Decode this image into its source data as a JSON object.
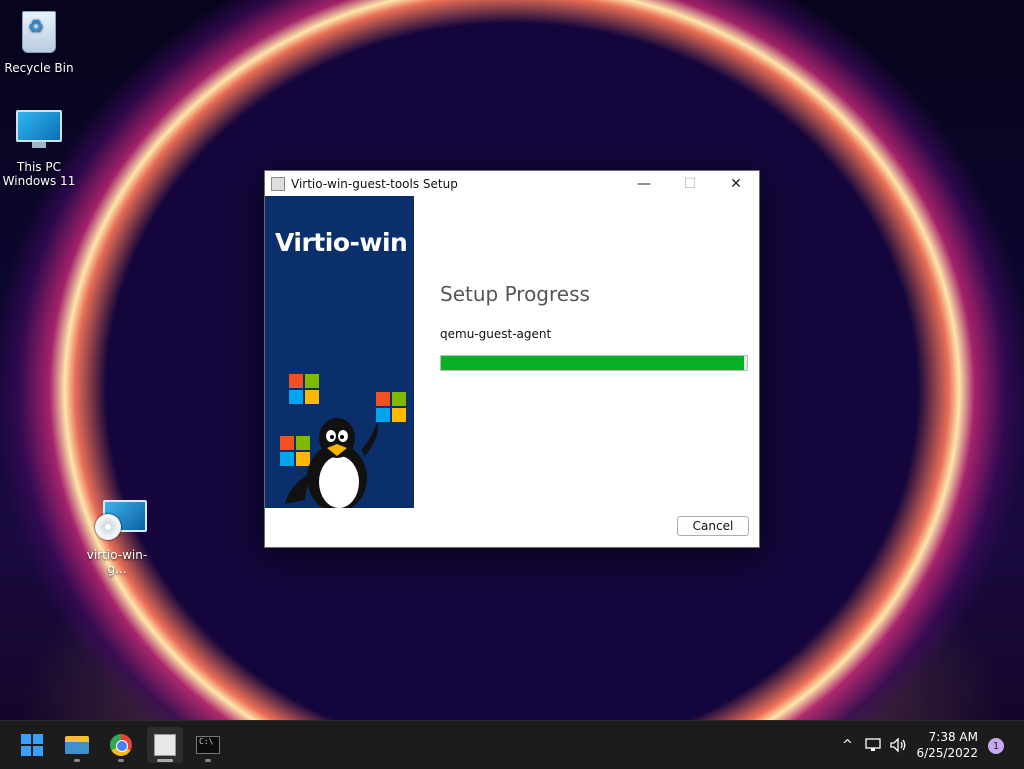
{
  "desktop": {
    "icons": [
      {
        "label": "Recycle Bin"
      },
      {
        "label_line1": "This PC",
        "label_line2": "Windows 11"
      },
      {
        "label": "virtio-win-g..."
      }
    ]
  },
  "window": {
    "title": "Virtio-win-guest-tools Setup",
    "banner_title": "Virtio-win",
    "heading": "Setup Progress",
    "status": "qemu-guest-agent",
    "progress_percent": 99,
    "progress_color": "#06b025",
    "cancel_label": "Cancel",
    "minimize_icon": "—",
    "maximize_icon": "☐",
    "close_icon": "✕"
  },
  "taskbar": {
    "items": [
      "start-icon",
      "file-explorer-icon",
      "chrome-icon",
      "virtio-setup-icon",
      "terminal-icon"
    ],
    "terminal_glyph": "C:\\",
    "tray": {
      "overflow_icon": "^",
      "network_icon": "network-icon",
      "volume_icon": "volume-icon",
      "time": "7:38 AM",
      "date": "6/25/2022",
      "notification_count": "1"
    }
  }
}
